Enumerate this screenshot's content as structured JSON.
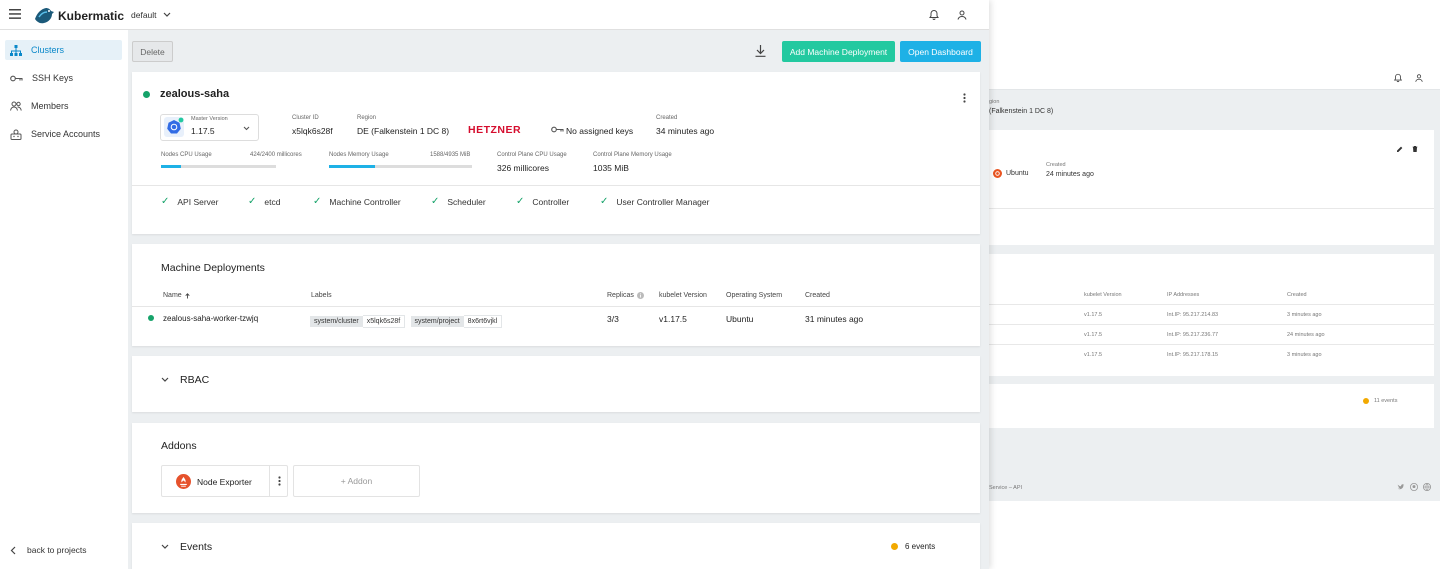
{
  "app": {
    "name": "Kubermatic",
    "project": "default"
  },
  "sidebar": {
    "items": [
      {
        "label": "Clusters"
      },
      {
        "label": "SSH Keys"
      },
      {
        "label": "Members"
      },
      {
        "label": "Service Accounts"
      }
    ],
    "back_label": "back to projects"
  },
  "toolbar": {
    "delete_label": "Delete",
    "add_md_label": "Add Machine Deployment",
    "open_dashboard_label": "Open Dashboard"
  },
  "cluster": {
    "name": "zealous-saha",
    "master_version_label": "Master Version",
    "master_version": "1.17.5",
    "cluster_id_label": "Cluster ID",
    "cluster_id": "x5lqk6s28f",
    "region_label": "Region",
    "region": "DE (Falkenstein 1 DC 8)",
    "provider": "HETZNER",
    "ssh_keys": "No assigned keys",
    "created_label": "Created",
    "created": "34 minutes ago",
    "cpu_label": "Nodes CPU Usage",
    "cpu_value": "424/2400 millicores",
    "cpu_fraction": 0.177,
    "mem_label": "Nodes Memory Usage",
    "mem_value": "1588/4935 MiB",
    "mem_fraction": 0.322,
    "cp_cpu_label": "Control Plane CPU Usage",
    "cp_cpu": "326 millicores",
    "cp_mem_label": "Control Plane Memory Usage",
    "cp_mem": "1035 MiB",
    "health": [
      "API Server",
      "etcd",
      "Machine Controller",
      "Scheduler",
      "Controller",
      "User Controller Manager"
    ]
  },
  "machine_deployments": {
    "title": "Machine Deployments",
    "columns": {
      "name": "Name",
      "labels": "Labels",
      "replicas": "Replicas",
      "kubelet": "kubelet Version",
      "os": "Operating System",
      "created": "Created"
    },
    "rows": [
      {
        "name": "zealous-saha-worker-tzwjq",
        "label1_key": "system/cluster",
        "label1_val": "x5lqk6s28f",
        "label2_key": "system/project",
        "label2_val": "8x6rt6vjkl",
        "replicas": "3/3",
        "kubelet": "v1.17.5",
        "os": "Ubuntu",
        "created": "31 minutes ago"
      }
    ]
  },
  "rbac": {
    "title": "RBAC"
  },
  "addons": {
    "title": "Addons",
    "items": [
      {
        "name": "Node Exporter"
      }
    ],
    "add_label": "+ Addon"
  },
  "events": {
    "title": "Events",
    "count": "6 events"
  },
  "background": {
    "region_fragment": "gion",
    "region_text": "(Falkenstein 1 DC 8)",
    "os": "Ubuntu",
    "created_label": "Created",
    "created": "24 minutes ago",
    "columns": {
      "kubelet": "kubelet Version",
      "ip": "IP Addresses",
      "created": "Created"
    },
    "rows": [
      {
        "kubelet": "v1.17.5",
        "ip": "Int.IP: 95.217.214.83",
        "created": "3 minutes ago"
      },
      {
        "kubelet": "v1.17.5",
        "ip": "Int.IP: 95.217.236.77",
        "created": "24 minutes ago"
      },
      {
        "kubelet": "v1.17.5",
        "ip": "Int.IP: 95.217.178.15",
        "created": "3 minutes ago"
      }
    ],
    "events_count": "11 events",
    "footer": "Service – API"
  },
  "colors": {
    "accent": "#0a88c9",
    "primary_button": "#1eb1e6",
    "teal_button": "#23c9a0",
    "success": "#16a36a",
    "warning": "#f2a900",
    "hetzner": "#d50c2d",
    "ubuntu": "#e95420",
    "prometheus": "#e6522c"
  },
  "icons": [
    "menu-icon",
    "kubermatic-logo-icon",
    "chevron-down-icon",
    "bell-icon",
    "user-icon",
    "clusters-icon",
    "key-icon",
    "members-icon",
    "service-accounts-icon",
    "chevron-left-icon",
    "download-icon",
    "more-vert-icon",
    "kubernetes-icon",
    "check-icon",
    "info-icon",
    "sort-arrow-icon",
    "chevron-expand-icon",
    "prometheus-icon",
    "edit-icon",
    "delete-icon"
  ]
}
